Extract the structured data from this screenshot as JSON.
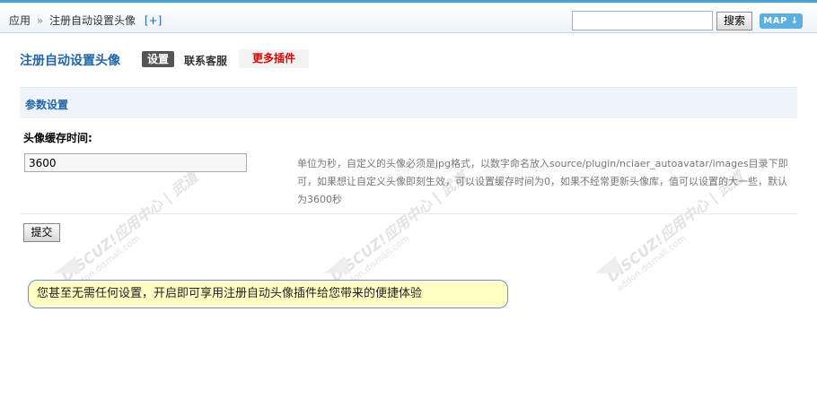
{
  "header": {
    "breadcrumb_root": "应用",
    "breadcrumb_sep": "»",
    "breadcrumb_current": "注册自动设置头像",
    "add_link": "[+]",
    "search_placeholder": "",
    "search_button": "搜索",
    "map_button": "MAP ↓"
  },
  "plugin": {
    "title": "注册自动设置头像",
    "tabs": [
      "设置",
      "联系客服",
      "更多插件"
    ]
  },
  "section": {
    "title": "参数设置"
  },
  "field": {
    "label": "头像缓存时间:",
    "value": "3600",
    "description": "单位为秒，自定义的头像必须是jpg格式，以数字命名放入source/plugin/nciaer_autoavatar/images目录下即可，如果想让自定义头像即刻生效，可以设置缓存时间为0，如果不经常更新头像库，值可以设置的大一些，默认为3600秒"
  },
  "actions": {
    "submit": "提交"
  },
  "notice": {
    "text": "您甚至无需任何设置，开启即可享用注册自动头像插件给您带来的便捷体验"
  },
  "watermark": {
    "text": "DISCUZ!应用中心 | 武道",
    "sub": "addon.dismall.com"
  },
  "colors": {
    "accent": "#2366a8",
    "more_plugins": "#e00000",
    "notice_bg": "#ffffc4",
    "notice_border": "#7b88e6"
  }
}
